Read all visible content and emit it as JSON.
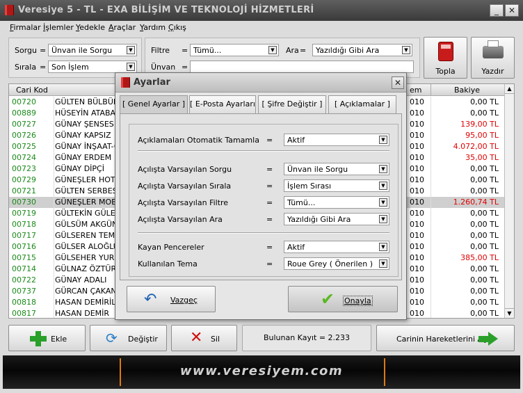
{
  "window": {
    "title": "Veresiye 5 - TL - EXA BİLİŞİM VE TEKNOLOJİ HİZMETLERİ",
    "min": "_",
    "close": "✕"
  },
  "menu": [
    "Firmalar",
    "İşlemler",
    "Yedekle",
    "Araçlar",
    "Yardım",
    "Çıkış"
  ],
  "filters": {
    "sorgu_label": "Sorgu",
    "sorgu_value": "Ünvan ile Sorgu",
    "sirala_label": "Sırala",
    "sirala_value": "Son İşlem",
    "filtre_label": "Filtre",
    "filtre_value": "Tümü...",
    "ara_label": "Ara",
    "ara_value": "Yazıldığı Gibi Ara",
    "unvan_label": "Ünvan",
    "unvan_value": "",
    "eq": "="
  },
  "toolbar": {
    "topla": "Topla",
    "yazdir": "Yazdır"
  },
  "grid": {
    "headers": {
      "kod": "Cari Kod",
      "tarih": "em",
      "bakiye": "Bakiye"
    },
    "rows": [
      {
        "kod": "00720",
        "name": "GÜLTEN BÜLBÜL",
        "tarih": "010",
        "bakiye": "0,00 TL",
        "neg": false
      },
      {
        "kod": "00889",
        "name": "HÜSEYİN ATABAY",
        "tarih": "010",
        "bakiye": "0,00 TL",
        "neg": false
      },
      {
        "kod": "00727",
        "name": "GÜNAY ŞENSES",
        "tarih": "010",
        "bakiye": "139,00 TL",
        "neg": true
      },
      {
        "kod": "00726",
        "name": "GÜNAY KAPSIZ",
        "tarih": "010",
        "bakiye": "95,00 TL",
        "neg": true
      },
      {
        "kod": "00725",
        "name": "GÜNAY İNŞAAT-Ö",
        "tarih": "010",
        "bakiye": "4.072,00 TL",
        "neg": true
      },
      {
        "kod": "00724",
        "name": "GÜNAY ERDEM",
        "tarih": "010",
        "bakiye": "35,00 TL",
        "neg": true
      },
      {
        "kod": "00723",
        "name": "GÜNAY DİPÇİ",
        "tarih": "010",
        "bakiye": "0,00 TL",
        "neg": false
      },
      {
        "kod": "00729",
        "name": "GÜNEŞLER HOTE",
        "tarih": "010",
        "bakiye": "0,00 TL",
        "neg": false
      },
      {
        "kod": "00721",
        "name": "GÜLTEN SERBES",
        "tarih": "010",
        "bakiye": "0,00 TL",
        "neg": false
      },
      {
        "kod": "00730",
        "name": "GÜNEŞLER MOBİ",
        "tarih": "010",
        "bakiye": "1.260,74 TL",
        "neg": true
      },
      {
        "kod": "00719",
        "name": "GÜLTEKİN GÜLEÇ",
        "tarih": "010",
        "bakiye": "0,00 TL",
        "neg": false
      },
      {
        "kod": "00718",
        "name": "GÜLSÜM AKGÜN",
        "tarih": "010",
        "bakiye": "0,00 TL",
        "neg": false
      },
      {
        "kod": "00717",
        "name": "GÜLSEREN TEMİ",
        "tarih": "010",
        "bakiye": "0,00 TL",
        "neg": false
      },
      {
        "kod": "00716",
        "name": "GÜLSER ALOĞLU",
        "tarih": "010",
        "bakiye": "0,00 TL",
        "neg": false
      },
      {
        "kod": "00715",
        "name": "GÜLSEHER YURD",
        "tarih": "010",
        "bakiye": "385,00 TL",
        "neg": true
      },
      {
        "kod": "00714",
        "name": "GÜLNAZ ÖZTÜRK",
        "tarih": "010",
        "bakiye": "0,00 TL",
        "neg": false
      },
      {
        "kod": "00722",
        "name": "GÜNAY ADALI",
        "tarih": "010",
        "bakiye": "0,00 TL",
        "neg": false
      },
      {
        "kod": "00737",
        "name": "GÜRCAN ÇAKAN",
        "tarih": "010",
        "bakiye": "0,00 TL",
        "neg": false
      },
      {
        "kod": "00818",
        "name": "HASAN DEMİRİL",
        "tarih": "010",
        "bakiye": "0,00 TL",
        "neg": false
      },
      {
        "kod": "00817",
        "name": "HASAN DEMİR",
        "tarih": "010",
        "bakiye": "0,00 TL",
        "neg": false
      }
    ]
  },
  "bottom": {
    "ekle": "Ekle",
    "degistir": "Değiştir",
    "sil": "Sil",
    "bulunan": "Bulunan Kayıt = 2.233",
    "hareket": "Carinin Hareketlerini Aç"
  },
  "banner": "www.veresiyem.com",
  "dialog": {
    "title": "Ayarlar",
    "close": "✕",
    "tabs": [
      "[ Genel Ayarlar ]",
      "[ E-Posta Ayarları ]",
      "[ Şifre Değiştir ]",
      "[ Açıklamalar ]"
    ],
    "eq": "=",
    "settings": [
      {
        "label": "Açıklamaları Otomatik Tamamla",
        "value": "Aktif"
      },
      {
        "label": "Açılışta Varsayılan Sorgu",
        "value": "Ünvan ile Sorgu"
      },
      {
        "label": "Açılışta Varsayılan Sırala",
        "value": "İşlem Sırası"
      },
      {
        "label": "Açılışta Varsayılan Filtre",
        "value": "Tümü..."
      },
      {
        "label": "Açılışta Varsayılan Ara",
        "value": "Yazıldığı Gibi Ara"
      },
      {
        "label": "Kayan Pencereler",
        "value": "Aktif"
      },
      {
        "label": "Kullanılan Tema",
        "value": "Roue Grey ( Önerilen )"
      }
    ],
    "vazgec": "Vazgeç",
    "onayla": "Onayla"
  },
  "colors": {
    "green": "#1a8a1a",
    "red": "#e00000",
    "accent_orange": "#e07a10"
  }
}
